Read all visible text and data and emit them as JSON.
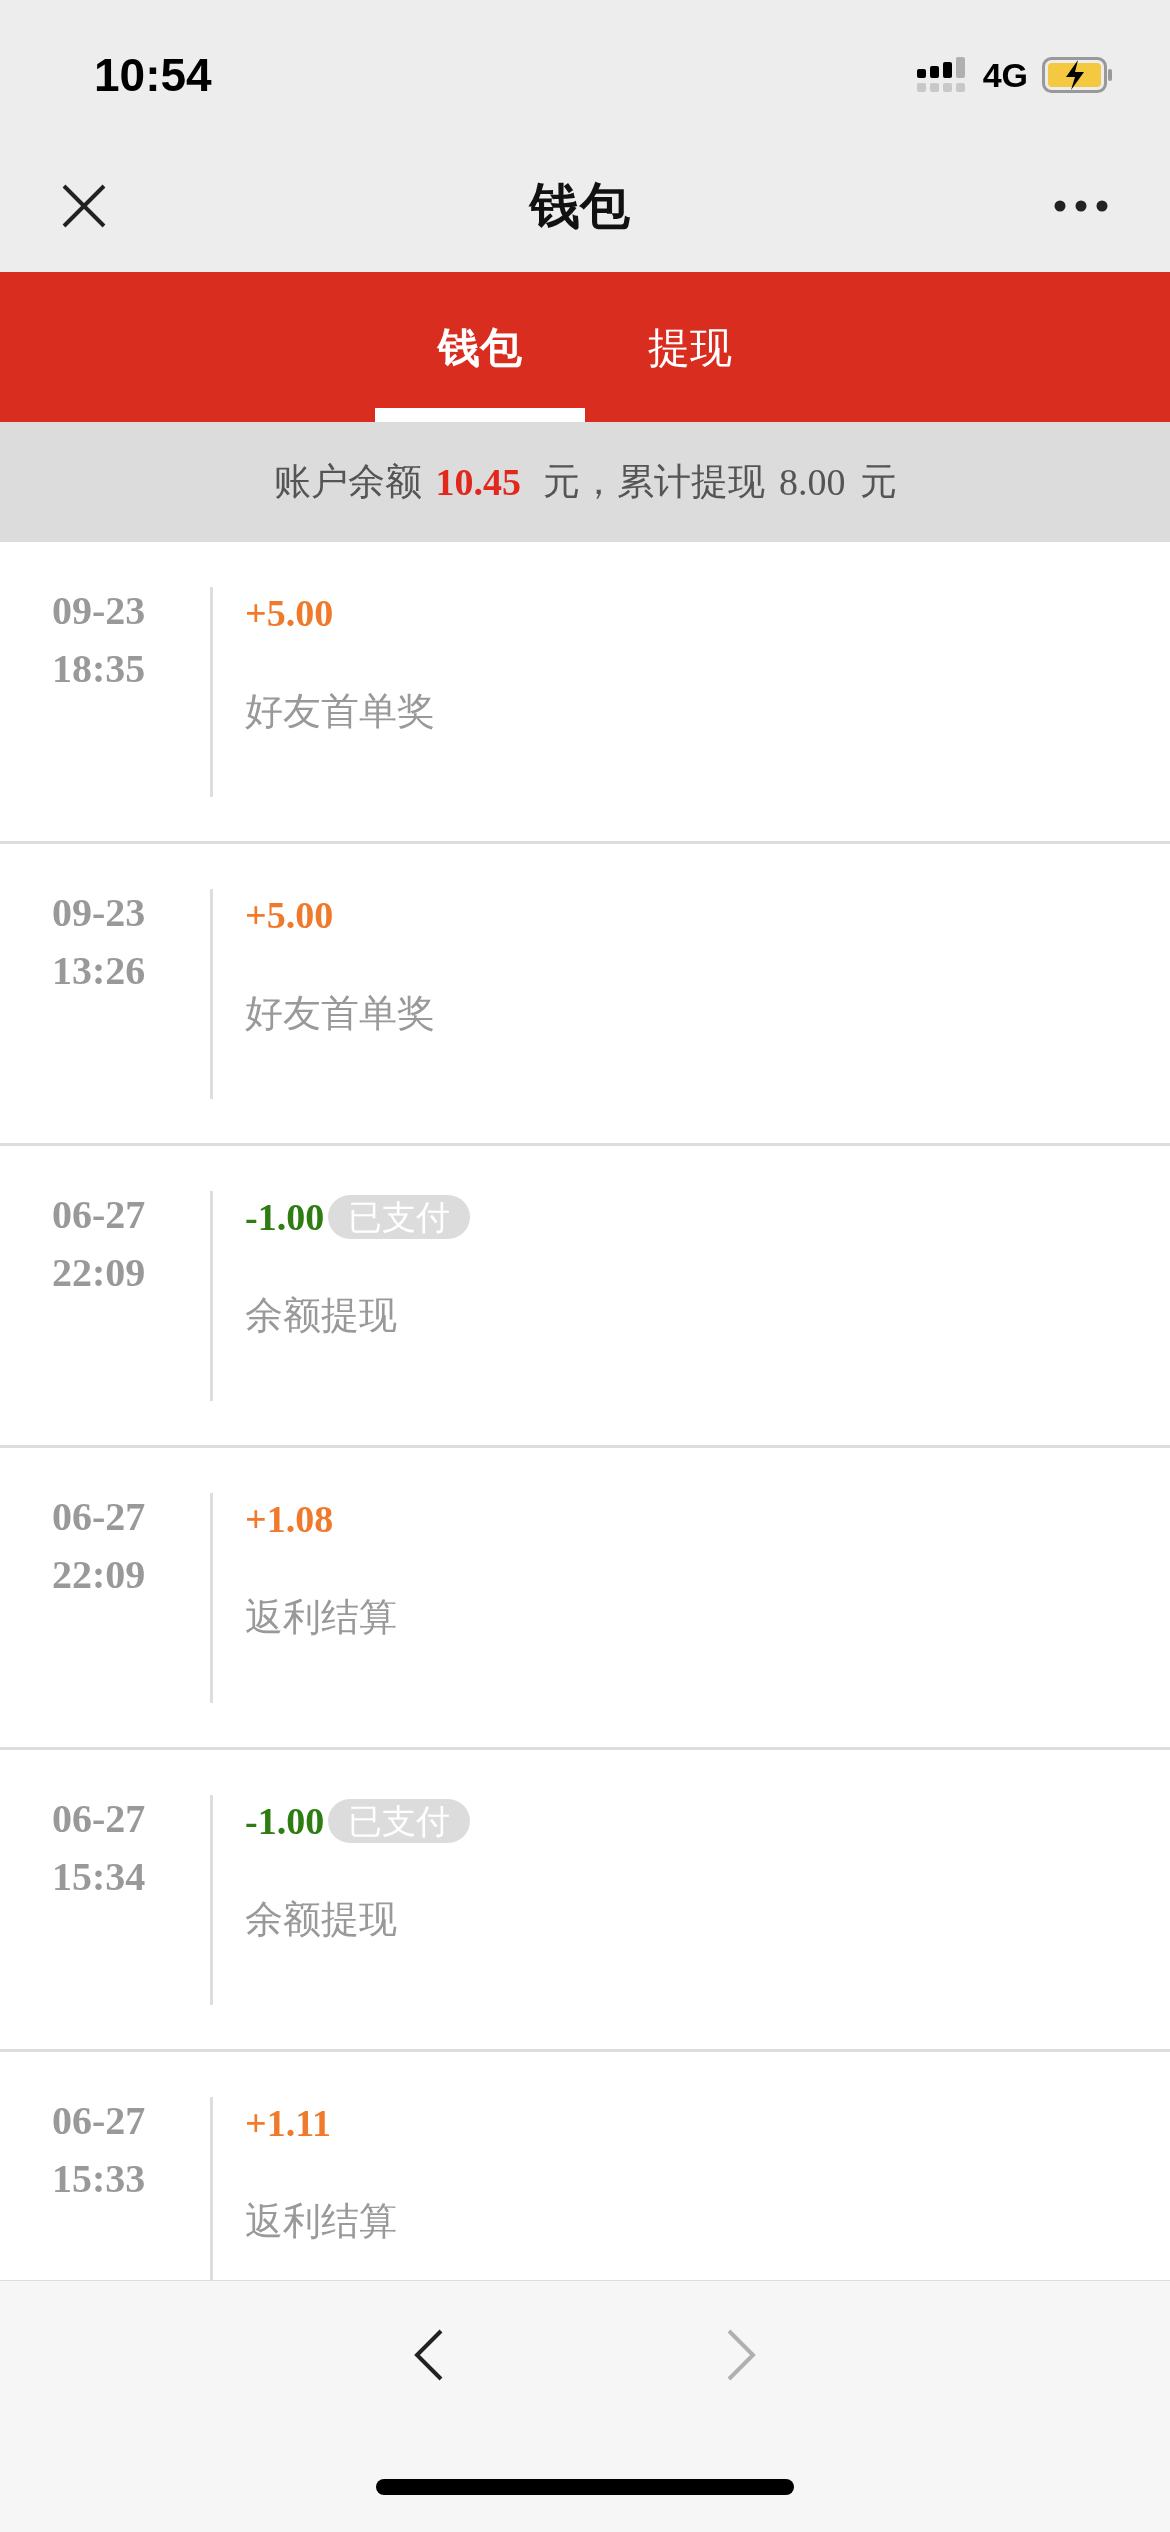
{
  "status_bar": {
    "time": "10:54",
    "network": "4G"
  },
  "nav_bar": {
    "title": "钱包"
  },
  "tabs": [
    {
      "label": "钱包",
      "selected": true
    },
    {
      "label": "提现",
      "selected": false
    }
  ],
  "summary": {
    "balance_label": "账户余额",
    "balance": "10.45",
    "withdrawn_label": "元，累计提现",
    "withdrawn": "8.00",
    "unit": "元"
  },
  "transactions": [
    {
      "date": "09-23",
      "time": "18:35",
      "amount": "+5.00",
      "kind": "income",
      "description": "好友首单奖"
    },
    {
      "date": "09-23",
      "time": "13:26",
      "amount": "+5.00",
      "kind": "income",
      "description": "好友首单奖"
    },
    {
      "date": "06-27",
      "time": "22:09",
      "amount": "-1.00",
      "kind": "withdrawal",
      "badge": "已支付",
      "description": "余额提现"
    },
    {
      "date": "06-27",
      "time": "22:09",
      "amount": "+1.08",
      "kind": "income",
      "description": "返利结算"
    },
    {
      "date": "06-27",
      "time": "15:34",
      "amount": "-1.00",
      "kind": "withdrawal",
      "badge": "已支付",
      "description": "余额提现"
    },
    {
      "date": "06-27",
      "time": "15:33",
      "amount": "+1.11",
      "kind": "income",
      "description": "返利结算"
    }
  ],
  "toolbar": {
    "back": {
      "disabled": false
    },
    "forward": {
      "disabled": true
    }
  }
}
